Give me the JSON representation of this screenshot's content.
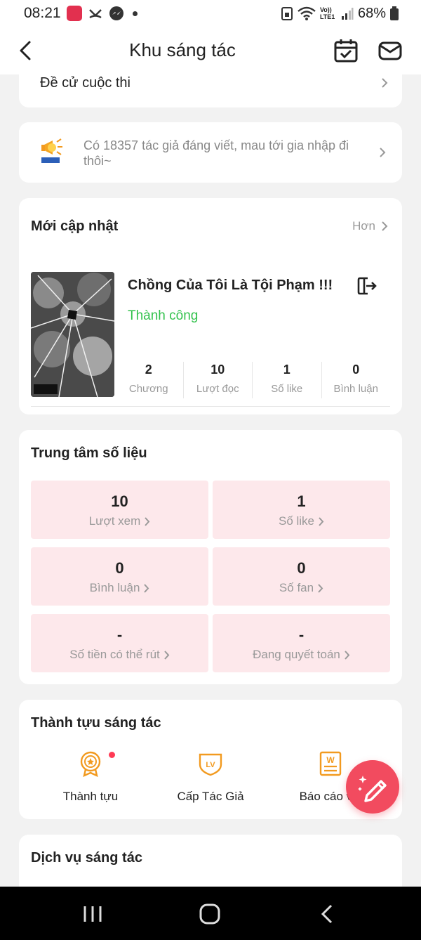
{
  "status_bar": {
    "time": "08:21",
    "battery": "68%",
    "network_label": "Vo)) LTE1"
  },
  "nav": {
    "title": "Khu sáng tác",
    "back_icon": "chevron-left-icon",
    "calendar_icon": "calendar-check-icon",
    "mail_icon": "mail-icon"
  },
  "nominate": {
    "label": "Đề cử cuộc thi"
  },
  "notice": {
    "text": "Có 18357 tác giả đáng viết, mau tới gia nhập đi thôi~",
    "icon": "megaphone-icon"
  },
  "updates": {
    "title": "Mới cập nhật",
    "more_label": "Hơn",
    "book": {
      "title": "Chồng Của Tôi Là Tội Phạm !!!",
      "status": "Thành công",
      "status_color": "#33c24d",
      "stats": [
        {
          "value": "2",
          "label": "Chương"
        },
        {
          "value": "10",
          "label": "Lượt đọc"
        },
        {
          "value": "1",
          "label": "Số like"
        },
        {
          "value": "0",
          "label": "Bình luận"
        }
      ]
    }
  },
  "data_center": {
    "title": "Trung tâm số liệu",
    "tiles": [
      {
        "value": "10",
        "label": "Lượt xem"
      },
      {
        "value": "1",
        "label": "Số like"
      },
      {
        "value": "0",
        "label": "Bình luận"
      },
      {
        "value": "0",
        "label": "Số fan"
      },
      {
        "value": "-",
        "label": "Số tiền có thể rút"
      },
      {
        "value": "-",
        "label": "Đang quyết toán"
      }
    ]
  },
  "achievements": {
    "title": "Thành tựu sáng tác",
    "items": [
      {
        "label": "Thành tựu",
        "icon": "medal-icon",
        "has_badge": true
      },
      {
        "label": "Cấp Tác Giả",
        "icon": "level-shield-icon",
        "has_badge": false
      },
      {
        "label": "Báo cáo vin",
        "icon": "report-document-icon",
        "has_badge": false
      }
    ]
  },
  "services": {
    "title": "Dịch vụ sáng tác"
  },
  "fab": {
    "icon": "pencil-sparkle-icon"
  },
  "colors": {
    "accent": "#f24b5f",
    "tile_bg": "#fde8eb",
    "icon_orange": "#f29a1f",
    "success": "#33c24d"
  }
}
